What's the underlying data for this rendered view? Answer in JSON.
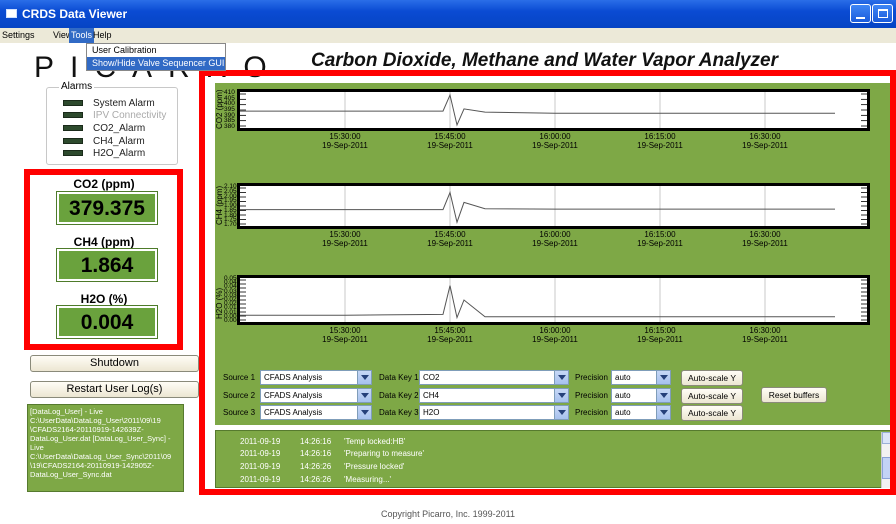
{
  "window": {
    "title": "CRDS Data Viewer"
  },
  "menu": {
    "items": [
      "Settings",
      "View",
      "Tools",
      "Help"
    ],
    "active": "Tools",
    "tools_dropdown": [
      "User Calibration",
      "Show/Hide Valve Sequencer GUI"
    ]
  },
  "logo_text": "PICARRO",
  "main_title": "Carbon Dioxide, Methane and Water Vapor Analyzer",
  "alarms": {
    "legend": "Alarms",
    "items": [
      "System Alarm",
      "IPV Connectivity",
      "CO2_Alarm",
      "CH4_Alarm",
      "H2O_Alarm"
    ]
  },
  "measurements": [
    {
      "label": "CO2 (ppm)",
      "value": "379.375"
    },
    {
      "label": "CH4 (ppm)",
      "value": "1.864"
    },
    {
      "label": "H2O (%)",
      "value": "0.004"
    }
  ],
  "buttons": {
    "shutdown": "Shutdown",
    "restart": "Restart User Log(s)",
    "reset": "Reset buffers",
    "autoscale": "Auto-scale Y"
  },
  "log_text": "[DataLog_User] - Live C:\\UserData\\DataLog_User\\2011\\09\\19 \\CFADS2164-20110919-142639Z-DataLog_User.dat [DataLog_User_Sync] - Live C:\\UserData\\DataLog_User_Sync\\2011\\09 \\19\\CFADS2164-20110919-142905Z-DataLog_User_Sync.dat",
  "chart_data": [
    {
      "type": "line",
      "ylabel": "CO2 (ppm)",
      "yticks": [
        "410",
        "405",
        "400",
        "395",
        "390",
        "385",
        "380"
      ],
      "ylim": [
        380,
        410
      ],
      "xticks": [
        {
          "time": "15:30:00",
          "date": "19-Sep-2011"
        },
        {
          "time": "15:45:00",
          "date": "19-Sep-2011"
        },
        {
          "time": "16:00:00",
          "date": "19-Sep-2011"
        },
        {
          "time": "16:15:00",
          "date": "19-Sep-2011"
        },
        {
          "time": "16:30:00",
          "date": "19-Sep-2011"
        }
      ],
      "series": [
        {
          "x": [
            "15:15",
            "15:30",
            "15:44",
            "15:45",
            "15:46",
            "15:47",
            "15:50",
            "16:00",
            "16:15",
            "16:30",
            "16:40"
          ],
          "values": [
            394,
            394,
            394,
            409,
            381,
            396,
            393,
            392,
            392,
            392,
            392
          ]
        }
      ]
    },
    {
      "type": "line",
      "ylabel": "CH4 (ppm)",
      "yticks": [
        "2.10",
        "2.05",
        "2.00",
        "1.95",
        "1.90",
        "1.85",
        "1.80",
        "1.75",
        "1.70"
      ],
      "ylim": [
        1.7,
        2.1
      ],
      "xticks": [
        {
          "time": "15:30:00",
          "date": "19-Sep-2011"
        },
        {
          "time": "15:45:00",
          "date": "19-Sep-2011"
        },
        {
          "time": "16:00:00",
          "date": "19-Sep-2011"
        },
        {
          "time": "16:15:00",
          "date": "19-Sep-2011"
        },
        {
          "time": "16:30:00",
          "date": "19-Sep-2011"
        }
      ],
      "series": [
        {
          "x": [
            "15:15",
            "15:30",
            "15:44",
            "15:45",
            "15:46",
            "15:47",
            "15:50",
            "16:00",
            "16:15",
            "16:30",
            "16:40"
          ],
          "values": [
            1.86,
            1.86,
            1.86,
            2.05,
            1.72,
            1.94,
            1.87,
            1.865,
            1.865,
            1.865,
            1.865
          ]
        }
      ]
    },
    {
      "type": "line",
      "ylabel": "H2O (%)",
      "yticks": [
        "0.050",
        "0.045",
        "0.040",
        "0.035",
        "0.030",
        "0.025",
        "0.020",
        "0.015",
        "0.010",
        "0.005",
        "0.000"
      ],
      "ylim": [
        0,
        0.05
      ],
      "xticks": [
        {
          "time": "15:30:00",
          "date": "19-Sep-2011"
        },
        {
          "time": "15:45:00",
          "date": "19-Sep-2011"
        },
        {
          "time": "16:00:00",
          "date": "19-Sep-2011"
        },
        {
          "time": "16:15:00",
          "date": "19-Sep-2011"
        },
        {
          "time": "16:30:00",
          "date": "19-Sep-2011"
        }
      ],
      "series": [
        {
          "x": [
            "15:15",
            "15:30",
            "15:44",
            "15:45",
            "15:46",
            "15:47",
            "15:50",
            "16:00",
            "16:15",
            "16:30",
            "16:40"
          ],
          "values": [
            0.006,
            0.006,
            0.007,
            0.043,
            0.003,
            0.025,
            0.004,
            0.004,
            0.004,
            0.004,
            0.004
          ]
        }
      ]
    }
  ],
  "controls": [
    {
      "source_label": "Source 1",
      "source": "CFADS Analysis",
      "key_label": "Data Key 1",
      "key": "CO2",
      "prec_label": "Precision",
      "precision": "auto"
    },
    {
      "source_label": "Source 2",
      "source": "CFADS Analysis",
      "key_label": "Data Key 2",
      "key": "CH4",
      "prec_label": "Precision",
      "precision": "auto"
    },
    {
      "source_label": "Source 3",
      "source": "CFADS Analysis",
      "key_label": "Data Key 3",
      "key": "H2O",
      "prec_label": "Precision",
      "precision": "auto"
    }
  ],
  "status_log": [
    {
      "date": "2011-09-19",
      "time": "14:26:16",
      "msg": "'Temp locked:HB'"
    },
    {
      "date": "2011-09-19",
      "time": "14:26:16",
      "msg": "'Preparing to measure'"
    },
    {
      "date": "2011-09-19",
      "time": "14:26:26",
      "msg": "'Pressure locked'"
    },
    {
      "date": "2011-09-19",
      "time": "14:26:26",
      "msg": "'Measuring...'"
    }
  ],
  "copyright": "Copyright Picarro, Inc. 1999-2011",
  "colors": {
    "panel_green": "#7ea846",
    "value_green": "#6aa23d",
    "highlight_red": "#ff0000",
    "titlebar_blue": "#0a4bd3"
  }
}
